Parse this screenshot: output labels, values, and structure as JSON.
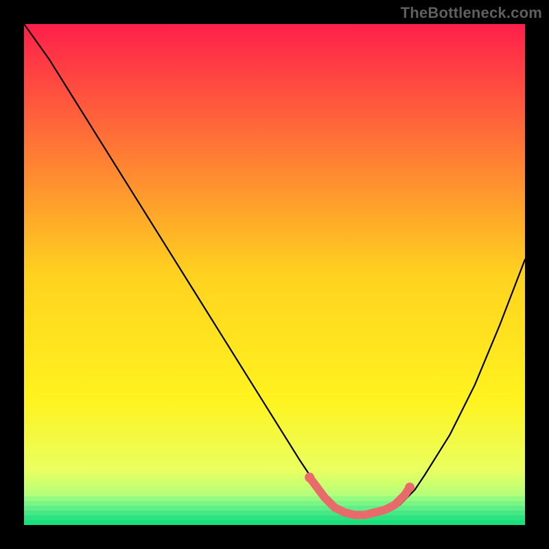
{
  "watermark": "TheBottleneck.com",
  "colors": {
    "background": "#000000",
    "curve": "#000000",
    "marker": "#e96a6a",
    "gradient_stops": [
      {
        "offset": 0.0,
        "color": "#ff1f4b"
      },
      {
        "offset": 0.5,
        "color": "#ffd21f"
      },
      {
        "offset": 0.75,
        "color": "#fff31f"
      },
      {
        "offset": 0.89,
        "color": "#eaff60"
      },
      {
        "offset": 0.94,
        "color": "#b5ff7a"
      },
      {
        "offset": 0.97,
        "color": "#6cf58d"
      },
      {
        "offset": 1.0,
        "color": "#19e07a"
      }
    ]
  },
  "chart_data": {
    "type": "line",
    "title": "",
    "xlabel": "",
    "ylabel": "",
    "xlim": [
      0,
      100
    ],
    "ylim": [
      0,
      100
    ],
    "series": [
      {
        "name": "bottleneck-curve",
        "x": [
          0,
          5,
          10,
          15,
          20,
          25,
          30,
          35,
          40,
          45,
          50,
          55,
          57,
          60,
          63,
          65,
          68,
          70,
          73,
          75,
          78,
          80,
          85,
          90,
          95,
          100
        ],
        "y": [
          100,
          93,
          85,
          77,
          69,
          61,
          53,
          45,
          37,
          29,
          21,
          13,
          10,
          6,
          3,
          2,
          2,
          2,
          3,
          4,
          7,
          10,
          18,
          28,
          40,
          53
        ]
      }
    ],
    "markers": {
      "name": "optimal-band",
      "points": [
        {
          "x": 57,
          "y": 9.5
        },
        {
          "x": 60,
          "y": 5.5
        },
        {
          "x": 62,
          "y": 3.5
        },
        {
          "x": 64,
          "y": 2.5
        },
        {
          "x": 66,
          "y": 2.0
        },
        {
          "x": 68,
          "y": 2.0
        },
        {
          "x": 70,
          "y": 2.5
        },
        {
          "x": 72,
          "y": 3.0
        },
        {
          "x": 74,
          "y": 4.0
        },
        {
          "x": 76,
          "y": 6.0
        },
        {
          "x": 77,
          "y": 7.5
        }
      ]
    }
  }
}
